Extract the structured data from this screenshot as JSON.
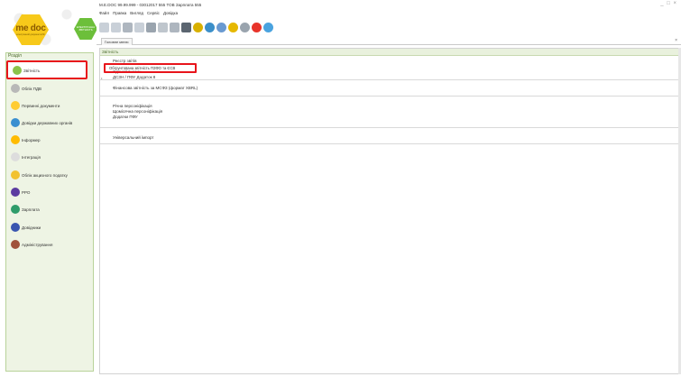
{
  "app": {
    "title": "M.E.DOC 99.99.999 - 03012017 555 ТОВ Зарплата 555",
    "window_controls": "_ □ ×",
    "logo_text": "me doc",
    "logo_sub": "електронний документообіг",
    "badge_text": "ЕЛЕКТРОННА ЗВІТНІСТЬ"
  },
  "menu": [
    "Файл",
    "Правка",
    "Вигляд",
    "Сервіс",
    "Довідка"
  ],
  "toolbar": {
    "icons": [
      "new-doc-icon",
      "open-doc-icon",
      "save-doc-icon",
      "copy-doc-icon",
      "filter-icon",
      "search-icon",
      "zoom-icon",
      "print-icon",
      "send-icon",
      "receive-icon",
      "settings-icon",
      "help-icon",
      "link-icon",
      "record-icon",
      "extra-icon"
    ],
    "colors": [
      "#c9d0d8",
      "#c9d0d8",
      "#aeb6bf",
      "#c9d0d8",
      "#9aa4ae",
      "#bfc6cd",
      "#aeb6bf",
      "#5b6570",
      "#d8b000",
      "#3b8fc9",
      "#6a9ad1",
      "#e6b800",
      "#9aa4ae",
      "#e8342a",
      "#4aa3df"
    ]
  },
  "tabs": [
    {
      "label": "Головне меню",
      "close": "×"
    }
  ],
  "sidebar": {
    "title": "Розділ",
    "items": [
      {
        "label": "Звітність",
        "color": "#8bc34a"
      },
      {
        "label": "Облік ПДВ",
        "color": "#b8b8b8"
      },
      {
        "label": "Первинні документи",
        "color": "#ffcc33"
      },
      {
        "label": "Довідки державних органів",
        "color": "#3a8fd0"
      },
      {
        "label": "Інформер",
        "color": "#ffbb00"
      },
      {
        "label": "Інтеграція",
        "color": "#dddddd"
      },
      {
        "label": "Облік акцизного податку",
        "color": "#f2c230"
      },
      {
        "label": "РРО",
        "color": "#5b3ba0"
      },
      {
        "label": "Зарплата",
        "color": "#2e9c6a"
      },
      {
        "label": "Довідники",
        "color": "#3a56b0"
      },
      {
        "label": "Адміністрування",
        "color": "#a0523a"
      }
    ]
  },
  "content": {
    "header": "Звітність",
    "groups": [
      {
        "lines": [
          "Реєстр звітів",
          "Обмін інформації",
          "Єдиний внесок",
          "ДСЗН / ПФУ Додаток 8"
        ]
      },
      {
        "lines": [
          "Фінансова звітність за МСФЗ (формат XBRL)"
        ]
      },
      {
        "lines": [
          "Річна персоніфікація",
          "Щомісячна персоніфікація",
          "Додатки ПФУ"
        ]
      },
      {
        "lines": [
          "Універсальний імпорт"
        ]
      }
    ],
    "selected_line": "Обгрунтована звітність ПЗФО та ЄСВ",
    "marker": "•"
  }
}
